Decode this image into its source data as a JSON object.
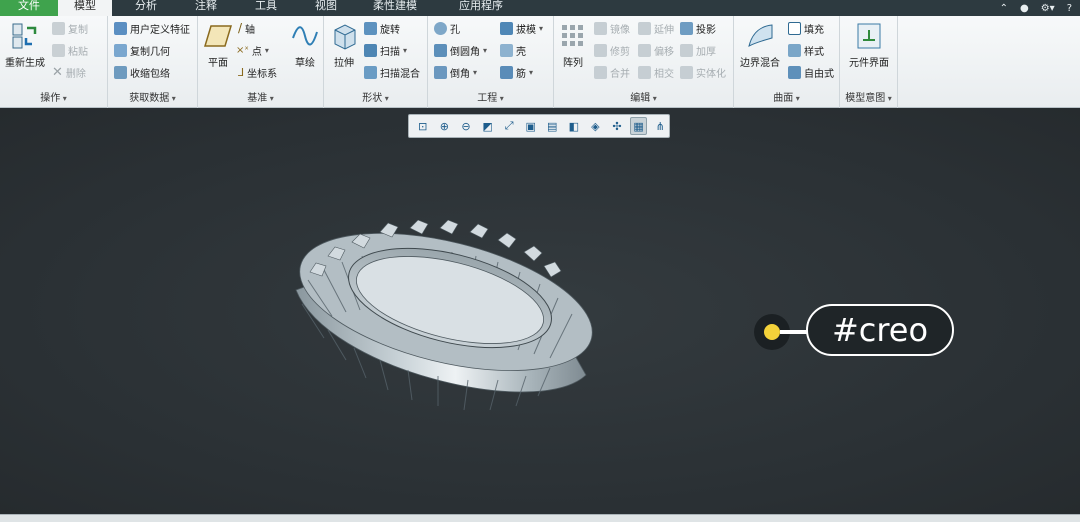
{
  "tabs": {
    "file": "文件",
    "model": "模型",
    "analysis": "分析",
    "annotate": "注释",
    "tools": "工具",
    "view": "视图",
    "flexible": "柔性建模",
    "apps": "应用程序"
  },
  "ribbon": {
    "operations": {
      "label": "操作",
      "regenerate": "重新生成",
      "copy": "复制",
      "paste": "粘贴",
      "delete": "删除"
    },
    "get_data": {
      "label": "获取数据",
      "udf": "用户定义特征",
      "copy_geom": "复制几何",
      "shrinkwrap": "收缩包络"
    },
    "datum": {
      "label": "基准",
      "plane": "平面",
      "axis": "轴",
      "point": "点",
      "csys": "坐标系",
      "sketch": "草绘"
    },
    "shapes": {
      "label": "形状",
      "extrude": "拉伸",
      "revolve": "旋转",
      "sweep": "扫描",
      "swept_blend": "扫描混合"
    },
    "engineering": {
      "label": "工程",
      "hole": "孔",
      "round": "倒圆角",
      "chamfer": "倒角",
      "draft": "拔模",
      "shell": "壳",
      "rib": "筋"
    },
    "editing": {
      "label": "编辑",
      "pattern": "阵列",
      "mirror": "镜像",
      "extend": "延伸",
      "project": "投影",
      "trim": "修剪",
      "offset": "偏移",
      "thicken": "加厚",
      "merge": "合并",
      "intersect": "相交",
      "solidify": "实体化"
    },
    "surfaces": {
      "label": "曲面",
      "boundary_blend": "边界混合",
      "fill": "填充",
      "style": "样式",
      "freeform": "自由式"
    },
    "model_intent": {
      "label": "模型意图",
      "component_interface": "元件界面"
    }
  },
  "tag": "#creo",
  "colors": {
    "accent_green": "#3fa34d",
    "viewport_bg": "#2c3236",
    "tag_dot": "#f4d23a"
  }
}
